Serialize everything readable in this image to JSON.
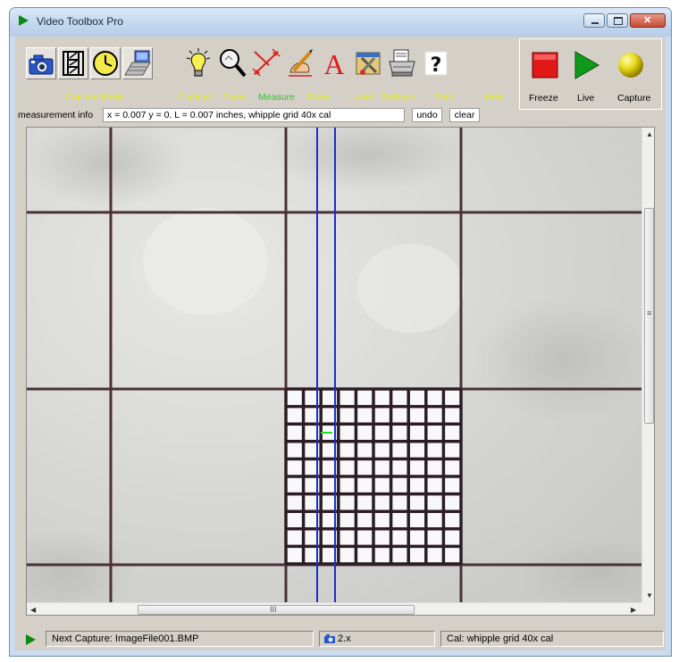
{
  "window": {
    "title": "Video Toolbox Pro",
    "title_icon": "play-icon"
  },
  "toolbar": {
    "icons": [
      "camera-icon",
      "film-icon",
      "clock-icon",
      "computer-icon",
      "lightbulb-icon",
      "magnifier-icon",
      "measure-icon",
      "draw-icon",
      "label-icon",
      "settings-icon",
      "print-icon",
      "help-icon"
    ],
    "labels": {
      "capture_mode": "Capture Mode",
      "contrast": "Contrast",
      "zoom": "Zoom",
      "measure": "Measure",
      "draw": "Draw",
      "label": "Label",
      "settings": "Settings",
      "print": "Print",
      "help": "Help"
    },
    "label_color": "#e3e81a",
    "active_label_color": "#2ec82a"
  },
  "controls": {
    "freeze": "Freeze",
    "live": "Live",
    "capture": "Capture"
  },
  "measurement": {
    "label": "measurement info",
    "value": "x = 0.007 y = 0. L = 0.007 inches, whipple grid 40x cal",
    "undo": "undo",
    "clear": "clear"
  },
  "scrollbar": {
    "grip": "≡",
    "hgrip": "III"
  },
  "status": {
    "next_capture": "Next Capture: ImageFile001.BMP",
    "zoom": "2.x",
    "calibration": "Cal: whipple grid 40x cal"
  },
  "overlay": {
    "line_color": "#1a2fc8",
    "marker_color": "#22e02a",
    "grid_color": "#4a3038"
  }
}
